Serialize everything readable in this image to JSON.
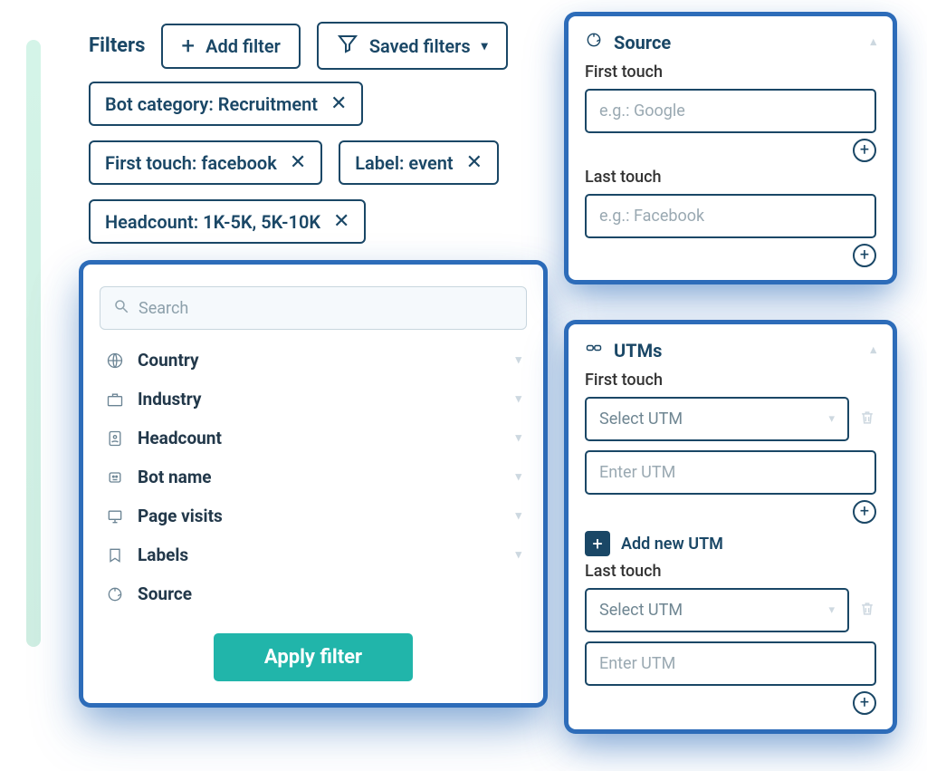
{
  "filters": {
    "title": "Filters",
    "add_label": "Add filter",
    "saved_label": "Saved filters",
    "chips": [
      {
        "text": "Bot category: Recruitment"
      },
      {
        "text": "First touch: facebook"
      },
      {
        "text": "Label: event"
      },
      {
        "text": "Headcount: 1K-5K, 5K-10K"
      }
    ]
  },
  "filter_panel": {
    "search_placeholder": "Search",
    "items": [
      "Country",
      "Industry",
      "Headcount",
      "Bot name",
      "Page visits",
      "Labels",
      "Source"
    ],
    "apply_label": "Apply filter"
  },
  "source_panel": {
    "title": "Source",
    "first_touch_label": "First touch",
    "first_touch_placeholder": "e.g.: Google",
    "last_touch_label": "Last touch",
    "last_touch_placeholder": "e.g.: Facebook"
  },
  "utm_panel": {
    "title": "UTMs",
    "first_touch_label": "First touch",
    "select_placeholder": "Select UTM",
    "enter_placeholder": "Enter UTM",
    "add_new_label": "Add new UTM",
    "last_touch_label": "Last touch"
  }
}
